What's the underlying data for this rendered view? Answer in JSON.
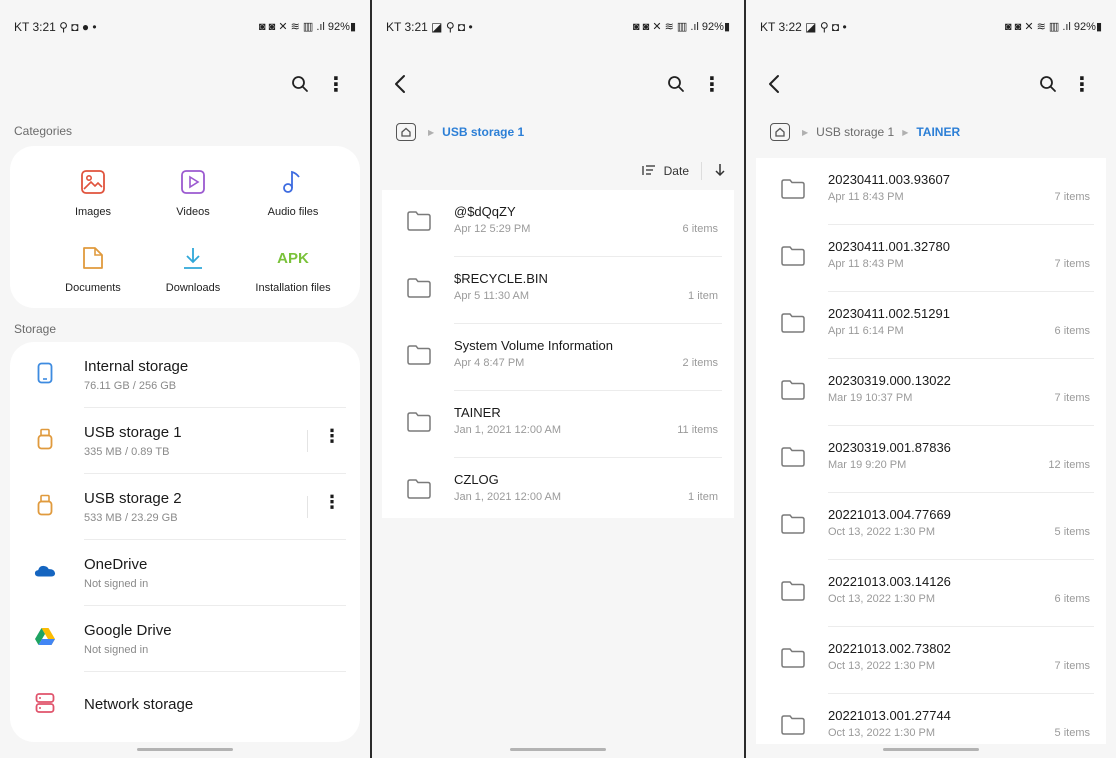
{
  "panel1": {
    "status_left": "KT 3:21 ⚲ ◘ ● •",
    "status_right": "◙ ◙ ✕ ≋ ▥ .ıl 92%▮",
    "categories_label": "Categories",
    "categories": [
      {
        "label": "Images",
        "icon": "image-icon",
        "color": "#e0533d"
      },
      {
        "label": "Videos",
        "icon": "video-icon",
        "color": "#9b59d0"
      },
      {
        "label": "Audio files",
        "icon": "music-icon",
        "color": "#3d6be0"
      },
      {
        "label": "Documents",
        "icon": "document-icon",
        "color": "#e09a3d"
      },
      {
        "label": "Downloads",
        "icon": "download-icon",
        "color": "#2fa7d8"
      },
      {
        "label": "Installation files",
        "icon": "apk-icon",
        "color": "#7ac23a",
        "text": "APK"
      }
    ],
    "storage_label": "Storage",
    "storage": [
      {
        "title": "Internal storage",
        "sub": "76.11 GB / 256 GB",
        "icon": "phone-icon"
      },
      {
        "title": "USB storage 1",
        "sub": "335 MB / 0.89 TB",
        "icon": "usb-icon"
      },
      {
        "title": "USB storage 2",
        "sub": "533 MB / 23.29 GB",
        "icon": "usb-icon"
      },
      {
        "title": "OneDrive",
        "sub": "Not signed in",
        "icon": "onedrive-icon"
      },
      {
        "title": "Google Drive",
        "sub": "Not signed in",
        "icon": "google-drive-icon"
      },
      {
        "title": "Network storage",
        "sub": "",
        "icon": "network-storage-icon"
      }
    ]
  },
  "panel2": {
    "status_left": "KT 3:21 ◪ ⚲ ◘ •",
    "status_right": "◙ ◙ ✕ ≋ ▥ .ıl 92%▮",
    "crumbs": [
      "USB storage 1"
    ],
    "sort_label": "Date",
    "folders": [
      {
        "name": "@$dQqZY",
        "date": "Apr 12 5:29 PM",
        "count": "6 items"
      },
      {
        "name": "$RECYCLE.BIN",
        "date": "Apr 5 11:30 AM",
        "count": "1 item"
      },
      {
        "name": "System Volume Information",
        "date": "Apr 4 8:47 PM",
        "count": "2 items"
      },
      {
        "name": "TAINER",
        "date": "Jan 1, 2021 12:00 AM",
        "count": "11 items"
      },
      {
        "name": "CZLOG",
        "date": "Jan 1, 2021 12:00 AM",
        "count": "1 item"
      }
    ]
  },
  "panel3": {
    "status_left": "KT 3:22 ◪ ⚲ ◘ •",
    "status_right": "◙ ◙ ✕ ≋ ▥ .ıl 92%▮",
    "crumbs": [
      "USB storage 1",
      "TAINER"
    ],
    "folders": [
      {
        "name": "20230411.003.93607",
        "date": "Apr 11 8:43 PM",
        "count": "7 items"
      },
      {
        "name": "20230411.001.32780",
        "date": "Apr 11 8:43 PM",
        "count": "7 items"
      },
      {
        "name": "20230411.002.51291",
        "date": "Apr 11 6:14 PM",
        "count": "6 items"
      },
      {
        "name": "20230319.000.13022",
        "date": "Mar 19 10:37 PM",
        "count": "7 items"
      },
      {
        "name": "20230319.001.87836",
        "date": "Mar 19 9:20 PM",
        "count": "12 items"
      },
      {
        "name": "20221013.004.77669",
        "date": "Oct 13, 2022 1:30 PM",
        "count": "5 items"
      },
      {
        "name": "20221013.003.14126",
        "date": "Oct 13, 2022 1:30 PM",
        "count": "6 items"
      },
      {
        "name": "20221013.002.73802",
        "date": "Oct 13, 2022 1:30 PM",
        "count": "7 items"
      },
      {
        "name": "20221013.001.27744",
        "date": "Oct 13, 2022 1:30 PM",
        "count": "5 items"
      }
    ]
  }
}
